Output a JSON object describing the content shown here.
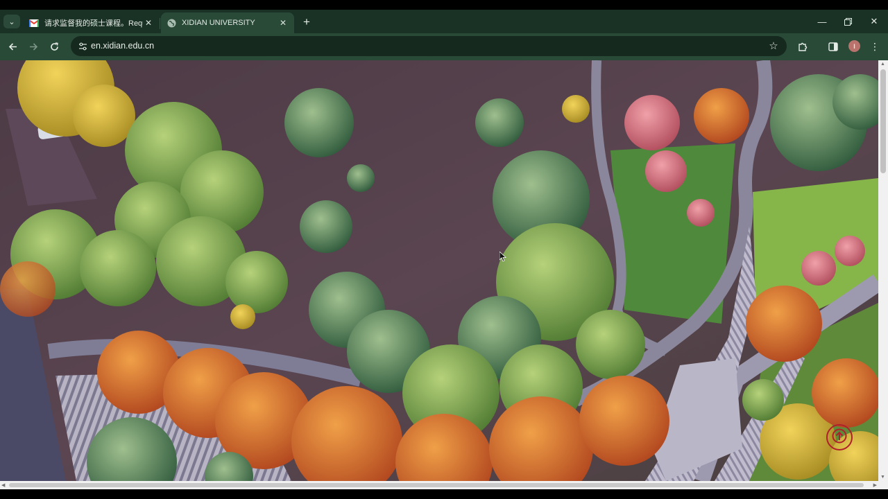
{
  "browser": {
    "tabs": [
      {
        "title": "请求监督我的硕士课程。Reque",
        "favicon": "gmail-icon",
        "active": false
      },
      {
        "title": "XIDIAN UNIVERSITY",
        "favicon": "globe-icon",
        "active": true
      }
    ],
    "url": "en.xidian.edu.cn",
    "profile_initial": "I",
    "icons": {
      "tab_search": "chevron-down-icon",
      "new_tab": "plus-icon",
      "back": "arrow-left-icon",
      "forward": "arrow-right-icon",
      "reload": "reload-icon",
      "site_info": "tune-icon",
      "bookmark": "star-icon",
      "extensions": "puzzle-icon",
      "side_panel": "side-panel-icon",
      "menu": "kebab-menu-icon",
      "minimize": "minimize-icon",
      "restore": "restore-icon",
      "close": "close-icon"
    }
  },
  "page": {
    "hero_image": "aerial-campus-autumn-forest",
    "back_to_top_icon": "arrow-up-circle-icon",
    "accent_color": "#b0202a"
  },
  "theme": {
    "chrome_bg": "#1e3a2b",
    "toolbar_bg": "#284a37",
    "omnibox_bg": "#15291e"
  }
}
